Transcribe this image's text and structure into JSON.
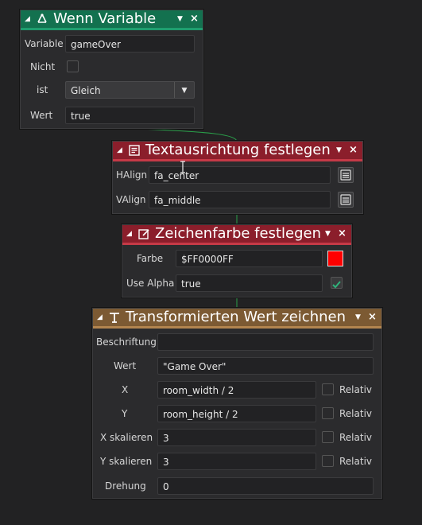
{
  "colors": {
    "if_header": "#13714f",
    "text_align_header": "#8b1e2b",
    "draw_colour_header": "#8b1e2b",
    "draw_transformed_header": "#7c5a33",
    "colour_swatch": "#ff0000",
    "wire": "#2aa04a"
  },
  "if_variable": {
    "title": "Wenn Variable",
    "icon": "branch-icon",
    "variable_label": "Variable",
    "variable_value": "gameOver",
    "not_label": "Nicht",
    "not_checked": false,
    "is_label": "ist",
    "is_value": "Gleich",
    "value_label": "Wert",
    "value_value": "true"
  },
  "text_align": {
    "title": "Textausrichtung festlegen",
    "icon": "paragraph-icon",
    "halign_label": "HAlign",
    "halign_value": "fa_center",
    "valign_label": "VAlign",
    "valign_value": "fa_middle"
  },
  "draw_colour": {
    "title": "Zeichenfarbe festlegen",
    "icon": "edit-colour-icon",
    "colour_label": "Farbe",
    "colour_value": "$FF0000FF",
    "use_alpha_label": "Use Alpha",
    "use_alpha_value": "true",
    "use_alpha_checked": true
  },
  "draw_transformed": {
    "title": "Transformierten Wert zeichnen",
    "icon": "text-icon",
    "caption_label": "Beschriftung",
    "caption_value": "",
    "value_label": "Wert",
    "value_value": "\"Game Over\"",
    "x_label": "X",
    "x_value": "room_width / 2",
    "y_label": "Y",
    "y_value": "room_height / 2",
    "xscale_label": "X skalieren",
    "xscale_value": "3",
    "yscale_label": "Y skalieren",
    "yscale_value": "3",
    "angle_label": "Drehung",
    "angle_value": "0",
    "relative_label": "Relativ"
  }
}
